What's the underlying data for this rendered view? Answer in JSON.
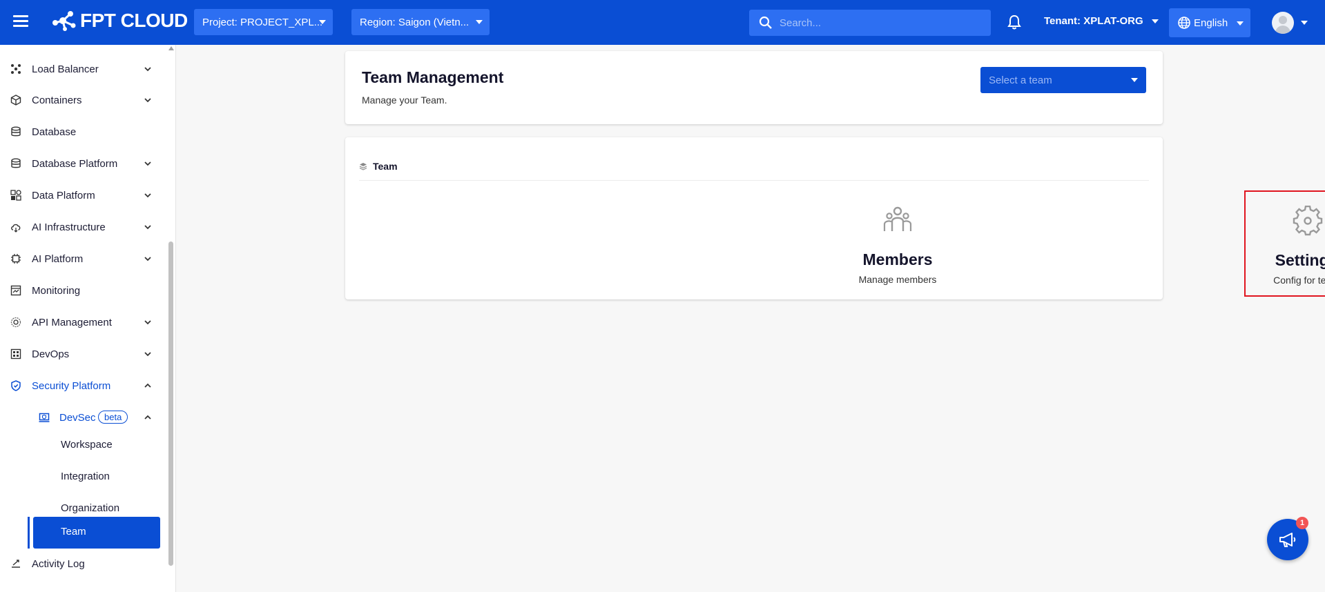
{
  "header": {
    "brand": "FPT CLOUD",
    "project_label": "Project: PROJECT_XPL...",
    "region_label": "Region: Saigon (Vietn...",
    "search_placeholder": "Search...",
    "tenant_label": "Tenant: XPLAT-ORG",
    "language_label": "English",
    "brand_color": "#0a4ed4"
  },
  "sidebar": {
    "items": [
      {
        "label": "Load Balancer",
        "icon": "load-balancer-icon"
      },
      {
        "label": "Containers",
        "icon": "cube-icon"
      },
      {
        "label": "Database",
        "icon": "database-icon"
      },
      {
        "label": "Database Platform",
        "icon": "database-platform-icon"
      },
      {
        "label": "Data Platform",
        "icon": "data-platform-icon"
      },
      {
        "label": "AI Infrastructure",
        "icon": "cloud-sync-icon"
      },
      {
        "label": "AI Platform",
        "icon": "chip-icon"
      },
      {
        "label": "Monitoring",
        "icon": "monitoring-icon"
      },
      {
        "label": "API Management",
        "icon": "api-icon"
      },
      {
        "label": "DevOps",
        "icon": "devops-icon"
      },
      {
        "label": "Security Platform",
        "icon": "shield-icon"
      }
    ],
    "devsec": {
      "label": "DevSec",
      "badge": "beta"
    },
    "devsec_children": [
      "Workspace",
      "Integration",
      "Organization",
      "Team"
    ],
    "activity_log": "Activity Log"
  },
  "main": {
    "title": "Team Management",
    "subtitle": "Manage your Team.",
    "team_select_placeholder": "Select a team",
    "section_title": "Team",
    "tiles": [
      {
        "name": "Members",
        "desc": "Manage members",
        "icon": "members-icon"
      },
      {
        "name": "Settings",
        "desc": "Config for team",
        "icon": "gear-icon"
      }
    ]
  },
  "fab": {
    "badge": "1",
    "icon": "megaphone-icon"
  },
  "highlight_color": "#e0141e"
}
